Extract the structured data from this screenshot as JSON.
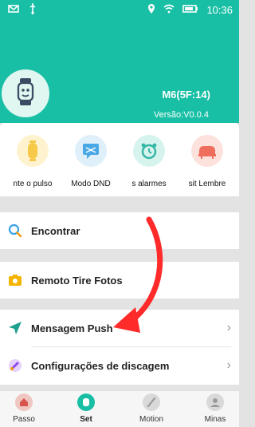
{
  "status": {
    "time": "10:36",
    "icons": [
      "mail-icon",
      "usb-icon",
      "location-icon",
      "wifi-icon",
      "battery-icon"
    ]
  },
  "device": {
    "name": "M6(5F:14)",
    "version": "Versão:V0.0.4"
  },
  "quick_actions": [
    {
      "label": "nte o pulso",
      "icon": "raise-wrist-icon",
      "color": "#f7c948",
      "bg": "#fff3cf"
    },
    {
      "label": "Modo DND",
      "icon": "dnd-icon",
      "color": "#4aa8e5",
      "bg": "#dff0fb"
    },
    {
      "label": "s alarmes",
      "icon": "alarm-icon",
      "color": "#35b7a6",
      "bg": "#d7f3ee"
    },
    {
      "label": "sit Lembre",
      "icon": "sit-reminder-icon",
      "color": "#ef6d5d",
      "bg": "#fde1dc"
    }
  ],
  "menu": {
    "find": "Encontrar",
    "remote_photo": "Remoto Tire Fotos",
    "push": "Mensagem Push",
    "dial": "Configurações de discagem"
  },
  "tabs": [
    {
      "label": "Passo",
      "icon": "home-icon"
    },
    {
      "label": "Set",
      "icon": "watch-icon"
    },
    {
      "label": "Motion",
      "icon": "motion-icon"
    },
    {
      "label": "Minas",
      "icon": "profile-icon"
    }
  ],
  "colors": {
    "teal": "#18bfa5",
    "arrow": "#ff2a2a"
  }
}
